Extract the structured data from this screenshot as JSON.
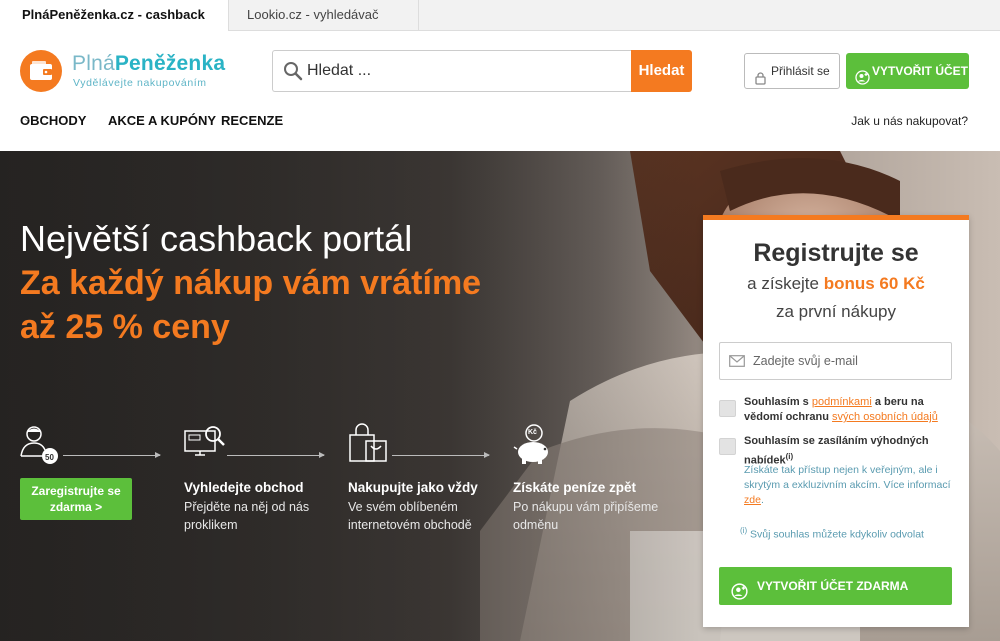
{
  "tabs": [
    {
      "label": "PlnáPeněženka.cz - cashback"
    },
    {
      "label": "Lookio.cz - vyhledávač módy"
    }
  ],
  "logo": {
    "name_light": "Plná",
    "name_bold": "Peněženka",
    "tagline": "Vydělávejte nakupováním"
  },
  "search": {
    "placeholder": "Hledat ...",
    "button": "Hledat"
  },
  "header": {
    "login": "Přihlásit se",
    "create_account": "VYTVOŘIT ÚČET"
  },
  "nav": {
    "items": [
      "OBCHODY",
      "AKCE A KUPÓNY",
      "RECENZE"
    ],
    "help": "Jak u nás nakupovat?"
  },
  "hero": {
    "title": "Největší cashback portál",
    "subtitle_line1": "Za každý nákup vám vrátíme",
    "subtitle_line2": "až 25 % ceny",
    "cta": "Zaregistrujte se zdarma >",
    "steps": [
      {
        "title": "",
        "desc": ""
      },
      {
        "title": "Vyhledejte obchod",
        "desc": "Přejděte na něj od nás proklikem"
      },
      {
        "title": "Nakupujte jako vždy",
        "desc": "Ve svém oblíbeném internetovém obchodě"
      },
      {
        "title": "Získáte peníze zpět",
        "desc": "Po nákupu vám připíšeme odměnu"
      }
    ],
    "badge": "50",
    "coin": "Kč"
  },
  "card": {
    "title": "Registrujte se",
    "sub_before": "a získejte ",
    "bonus": "bonus 60 Kč",
    "sub2": "za první nákupy",
    "email_placeholder": "Zadejte svůj e-mail",
    "consent1_a": "Souhlasím s ",
    "consent1_link": "podmínkami",
    "consent1_b": " a beru na vědomí ochranu ",
    "consent1_link2": "svých osobních údajů",
    "consent2": "Souhlasím se zasíláním výhodných nabídek",
    "consent2_sup": "(i)",
    "note": "Získáte tak přístup nejen k veřejným, ale i skrytým a exkluzivním akcím. Více informací ",
    "note_link": "zde",
    "note_end": ".",
    "revoke_sup": "(i)",
    "revoke": " Svůj souhlas můžete kdykoliv odvolat",
    "button": "VYTVOŘIT ÚČET ZDARMA"
  },
  "colors": {
    "orange": "#f47a20",
    "green": "#5cbf3b",
    "teal": "#2ab3c5"
  }
}
